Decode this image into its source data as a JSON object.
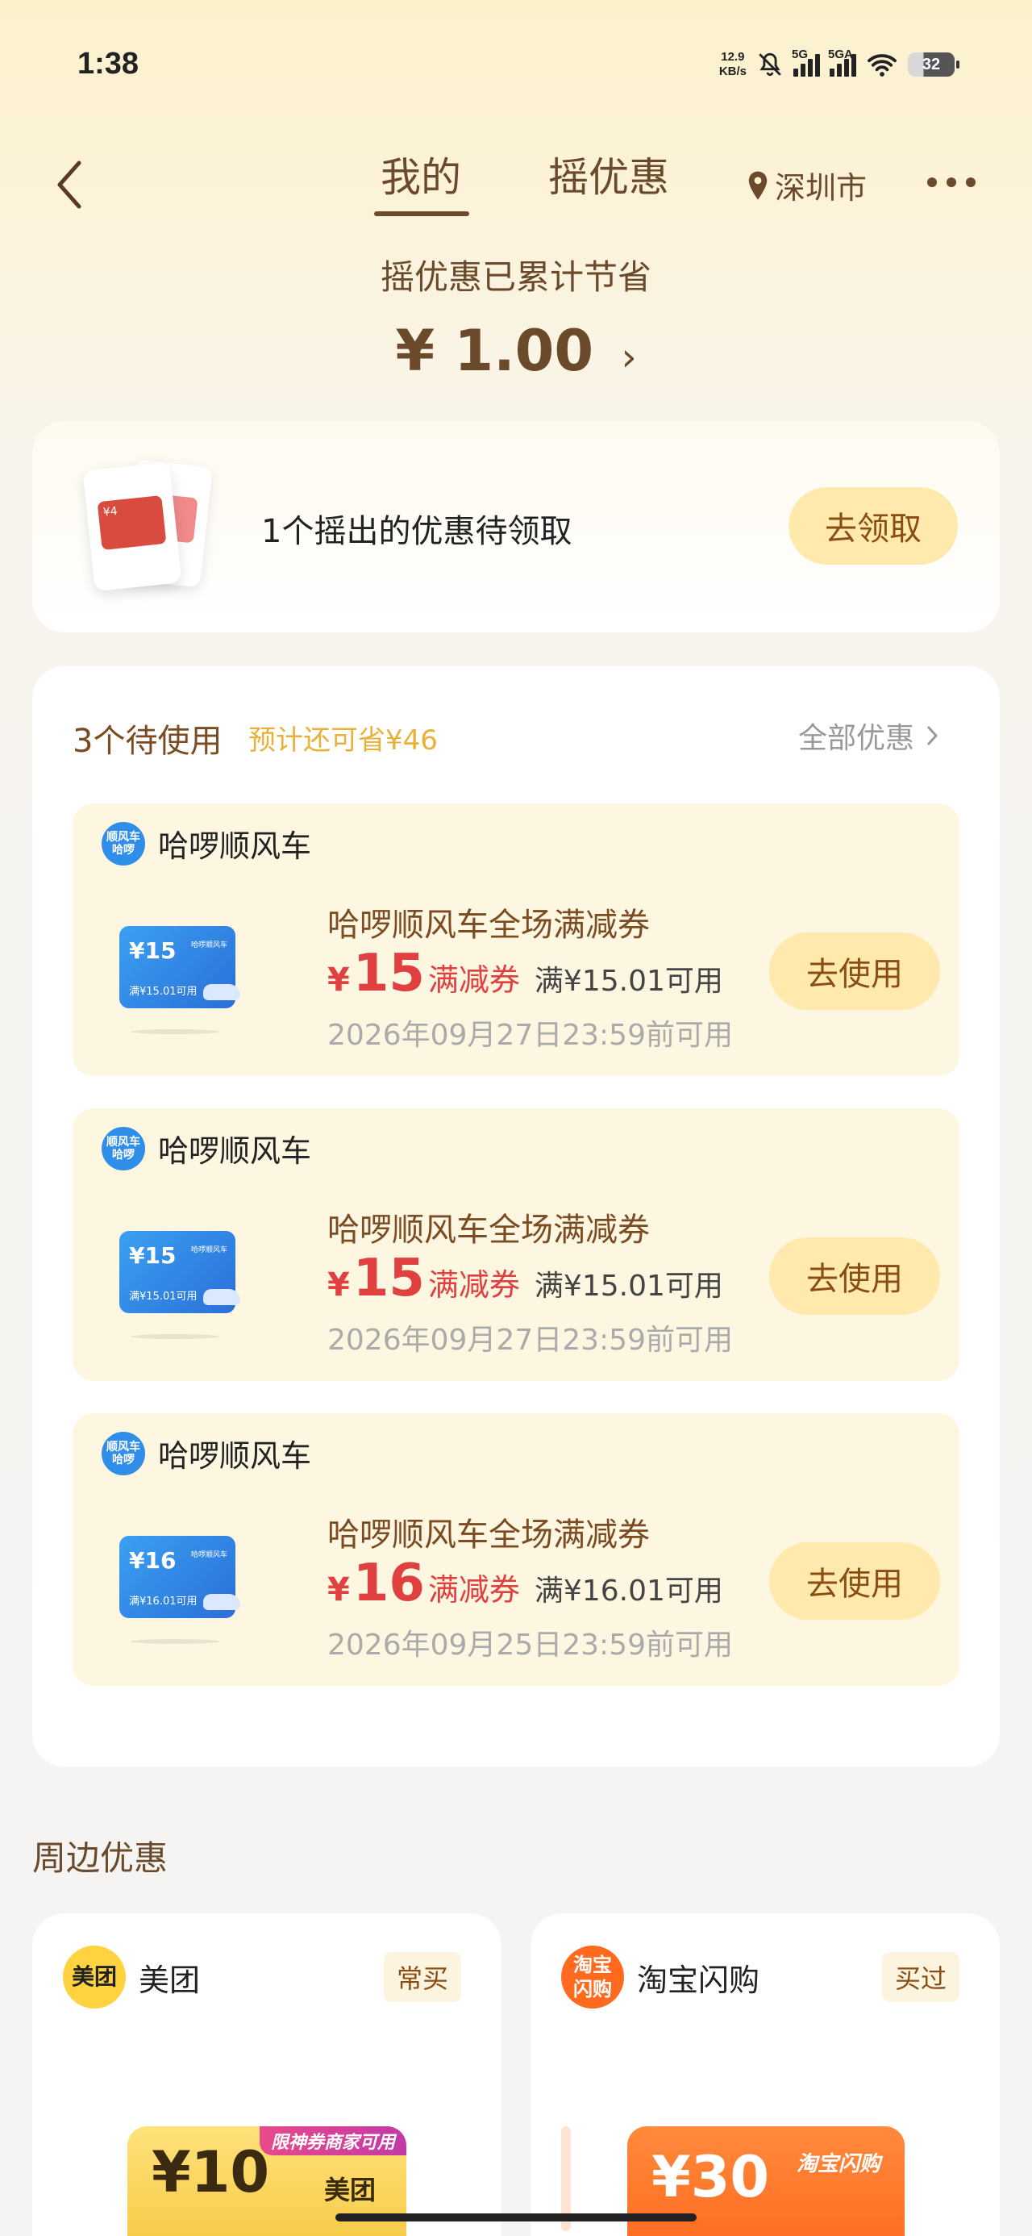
{
  "status": {
    "time": "1:38",
    "net_speed_value": "12.9",
    "net_speed_unit": "KB/s",
    "sim1": "5G",
    "sim2": "5GA",
    "battery": "32"
  },
  "header": {
    "tabs": [
      {
        "label": "我的",
        "active": true
      },
      {
        "label": "摇优惠",
        "active": false
      }
    ],
    "location": "深圳市"
  },
  "savings": {
    "label": "摇优惠已累计节省",
    "amount": "¥ 1.00",
    "chevron": "›"
  },
  "pending": {
    "text": "1个摇出的优惠待领取",
    "button": "去领取"
  },
  "list": {
    "title": "3个待使用",
    "subtitle": "预计还可省¥46",
    "all_link": "全部优惠",
    "coupons": [
      {
        "brand": "哈啰顺风车",
        "logo_top": "顺风车",
        "logo_bottom": "哈啰",
        "img_value": "¥15",
        "img_sub": "满¥15.01可用",
        "img_tag": "哈啰顺风车",
        "title": "哈啰顺风车全场满减券",
        "symbol": "¥",
        "amount": "15",
        "kind": "满减券",
        "condition": "满¥15.01可用",
        "expiry": "2026年09月27日23:59前可用",
        "button": "去使用"
      },
      {
        "brand": "哈啰顺风车",
        "logo_top": "顺风车",
        "logo_bottom": "哈啰",
        "img_value": "¥15",
        "img_sub": "满¥15.01可用",
        "img_tag": "哈啰顺风车",
        "title": "哈啰顺风车全场满减券",
        "symbol": "¥",
        "amount": "15",
        "kind": "满减券",
        "condition": "满¥15.01可用",
        "expiry": "2026年09月27日23:59前可用",
        "button": "去使用"
      },
      {
        "brand": "哈啰顺风车",
        "logo_top": "顺风车",
        "logo_bottom": "哈啰",
        "img_value": "¥16",
        "img_sub": "满¥16.01可用",
        "img_tag": "哈啰顺风车",
        "title": "哈啰顺风车全场满减券",
        "symbol": "¥",
        "amount": "16",
        "kind": "满减券",
        "condition": "满¥16.01可用",
        "expiry": "2026年09月25日23:59前可用",
        "button": "去使用"
      }
    ]
  },
  "nearby": {
    "title": "周边优惠",
    "cards": [
      {
        "brand": "美团",
        "logo": "美团",
        "tag": "常买",
        "ticket_value": "¥10",
        "ticket_banner": "限神券商家可用",
        "ticket_brand": "美团",
        "color": "#ffd23f"
      },
      {
        "brand": "淘宝闪购",
        "logo": "淘宝\n闪购",
        "tag": "买过",
        "ticket_value": "¥30",
        "ticket_banner": "淘宝闪购",
        "ticket_brand": "",
        "color": "#ff6a1f"
      }
    ]
  }
}
